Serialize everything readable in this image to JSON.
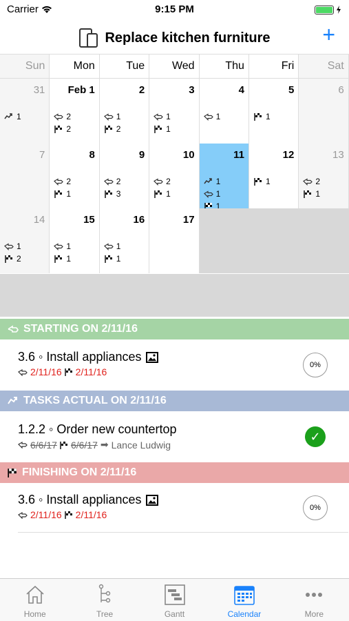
{
  "status": {
    "carrier": "Carrier",
    "time": "9:15 PM"
  },
  "nav": {
    "title": "Replace kitchen furniture",
    "add_label": "+"
  },
  "calendar": {
    "weekdays": [
      "Sun",
      "Mon",
      "Tue",
      "Wed",
      "Thu",
      "Fri",
      "Sat"
    ],
    "weeks": [
      [
        {
          "day": "31",
          "weekend": true,
          "counts": [
            {
              "type": "actual",
              "n": "1"
            }
          ]
        },
        {
          "day": "Feb 1",
          "counts": [
            {
              "type": "start",
              "n": "2"
            },
            {
              "type": "finish",
              "n": "2"
            }
          ]
        },
        {
          "day": "2",
          "counts": [
            {
              "type": "start",
              "n": "1"
            },
            {
              "type": "finish",
              "n": "2"
            }
          ]
        },
        {
          "day": "3",
          "counts": [
            {
              "type": "start",
              "n": "1"
            },
            {
              "type": "finish",
              "n": "1"
            }
          ]
        },
        {
          "day": "4",
          "counts": [
            {
              "type": "start",
              "n": "1"
            }
          ]
        },
        {
          "day": "5",
          "counts": [
            {
              "type": "finish",
              "n": "1"
            }
          ]
        },
        {
          "day": "6",
          "weekend": true,
          "counts": []
        }
      ],
      [
        {
          "day": "7",
          "weekend": true,
          "counts": []
        },
        {
          "day": "8",
          "counts": [
            {
              "type": "start",
              "n": "2"
            },
            {
              "type": "finish",
              "n": "1"
            }
          ]
        },
        {
          "day": "9",
          "counts": [
            {
              "type": "start",
              "n": "2"
            },
            {
              "type": "finish",
              "n": "3"
            }
          ]
        },
        {
          "day": "10",
          "counts": [
            {
              "type": "start",
              "n": "2"
            },
            {
              "type": "finish",
              "n": "1"
            }
          ]
        },
        {
          "day": "11",
          "selected": true,
          "counts": [
            {
              "type": "actual",
              "n": "1"
            },
            {
              "type": "start",
              "n": "1"
            },
            {
              "type": "finish",
              "n": "1"
            }
          ]
        },
        {
          "day": "12",
          "counts": [
            {
              "type": "finish",
              "n": "1"
            }
          ]
        },
        {
          "day": "13",
          "weekend": true,
          "counts": [
            {
              "type": "start",
              "n": "2"
            },
            {
              "type": "finish",
              "n": "1"
            }
          ]
        }
      ],
      [
        {
          "day": "14",
          "weekend": true,
          "counts": [
            {
              "type": "start",
              "n": "1"
            },
            {
              "type": "finish",
              "n": "2"
            }
          ]
        },
        {
          "day": "15",
          "counts": [
            {
              "type": "start",
              "n": "1"
            },
            {
              "type": "finish",
              "n": "1"
            }
          ]
        },
        {
          "day": "16",
          "counts": [
            {
              "type": "start",
              "n": "1"
            },
            {
              "type": "finish",
              "n": "1"
            }
          ]
        },
        {
          "day": "17",
          "counts": []
        },
        {
          "empty": true
        },
        {
          "empty": true
        },
        {
          "empty": true
        }
      ]
    ]
  },
  "sections": {
    "starting": {
      "label": "STARTING ON 2/11/16",
      "color": "#a5d4a5"
    },
    "actual": {
      "label": "TASKS ACTUAL ON 2/11/16",
      "color": "#a8b9d6"
    },
    "finishing": {
      "label": "FINISHING ON 2/11/16",
      "color": "#eaa8a8"
    }
  },
  "tasks": {
    "starting": {
      "title": "3.6 ◦ Install appliances",
      "start": "2/11/16",
      "finish": "2/11/16",
      "progress": "0%"
    },
    "actual": {
      "title": "1.2.2 ◦ Order new countertop",
      "start": "6/6/17",
      "finish": "6/6/17",
      "assignee": "Lance Ludwig",
      "done": true
    },
    "finishing": {
      "title": "3.6 ◦ Install appliances",
      "start": "2/11/16",
      "finish": "2/11/16",
      "progress": "0%"
    }
  },
  "tabs": [
    {
      "label": "Home",
      "icon": "home-icon"
    },
    {
      "label": "Tree",
      "icon": "tree-icon"
    },
    {
      "label": "Gantt",
      "icon": "gantt-icon"
    },
    {
      "label": "Calendar",
      "icon": "calendar-icon",
      "active": true
    },
    {
      "label": "More",
      "icon": "more-icon"
    }
  ],
  "colors": {
    "accent": "#1a82fb",
    "selected_day": "#85cdf9",
    "overdue": "#e0211c",
    "done": "#1ba01b"
  }
}
